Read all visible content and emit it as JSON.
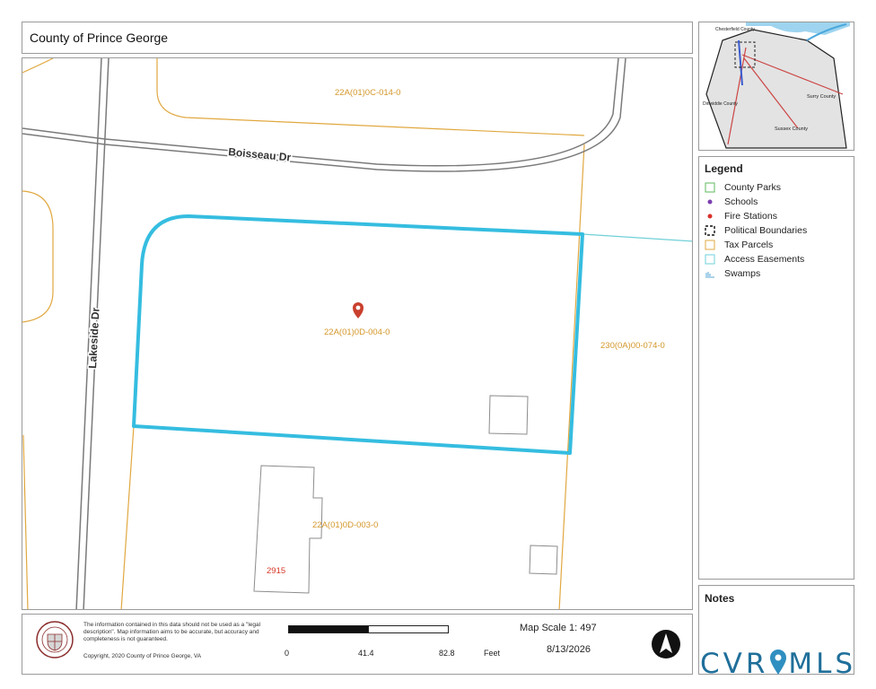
{
  "header": {
    "title": "County of Prince George"
  },
  "map": {
    "roads": [
      {
        "name": "Boisseau Dr"
      },
      {
        "name": "Lakeside Dr"
      }
    ],
    "parcels": [
      {
        "id": "22A(01)0C-014-0"
      },
      {
        "id": "22A(01)0D-004-0",
        "selected": true
      },
      {
        "id": "230(0A)00-074-0"
      },
      {
        "id": "22A(01)0D-003-0",
        "address": "2915"
      }
    ],
    "colors": {
      "parcel_line": "#e1a840",
      "parcel_label": "#d4972a",
      "selected_outline": "#35bde0",
      "easement": "#6fd0d8",
      "road_edge": "#7a7a7a",
      "address_label": "#d83a2a",
      "pin": "#c9402d"
    },
    "pin_icon": "map-pin-icon"
  },
  "inset": {
    "labels": [
      "Chesterfield County",
      "Dinwiddie County",
      "Surry County",
      "Sussex County"
    ]
  },
  "legend": {
    "title": "Legend",
    "items": [
      {
        "label": "County Parks",
        "icon": "green-square-icon"
      },
      {
        "label": "Schools",
        "icon": "purple-dot-icon"
      },
      {
        "label": "Fire Stations",
        "icon": "red-dot-icon"
      },
      {
        "label": "Political Boundaries",
        "icon": "dashed-square-icon"
      },
      {
        "label": "Tax Parcels",
        "icon": "tan-square-icon"
      },
      {
        "label": "Access Easements",
        "icon": "cyan-square-icon"
      },
      {
        "label": "Swamps",
        "icon": "swamp-icon"
      }
    ]
  },
  "notes": {
    "title": "Notes"
  },
  "footer": {
    "disclaimer": "The information contained in this data should not be used as a \"legal description\". Map information aims to be accurate, but accuracy and completeness is not guaranteed.",
    "copyright": "Copyright, 2020 County of Prince George, VA",
    "scale_label": "Map Scale 1: 497",
    "date": "8/13/2026",
    "scale_ticks": [
      "0",
      "41.4",
      "82.8"
    ],
    "scale_unit": "Feet"
  },
  "watermark": {
    "left": "CVR",
    "right": "MLS"
  }
}
